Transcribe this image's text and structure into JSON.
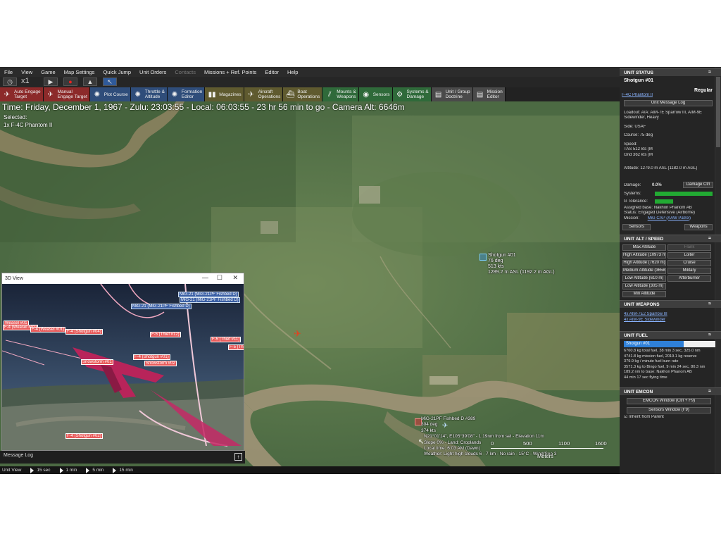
{
  "menu": [
    "File",
    "View",
    "Game",
    "Map Settings",
    "Quick Jump",
    "Unit Orders",
    "Contacts",
    "Missions + Ref. Points",
    "Editor",
    "Help"
  ],
  "sim": {
    "speed": "x1"
  },
  "toolbar": [
    {
      "label": "Auto Engage\nTarget",
      "icon": "crosshair-icon",
      "glyph": "✈",
      "style": "red"
    },
    {
      "label": "Manual\nEngage Target",
      "icon": "crosshair-icon",
      "glyph": "✈",
      "style": "red"
    },
    {
      "label": "Plot Course",
      "icon": "compass-icon",
      "glyph": "✺",
      "style": "blue"
    },
    {
      "label": "Throttle &\nAltitude",
      "icon": "gauge-icon",
      "glyph": "✺",
      "style": "blue"
    },
    {
      "label": "Formation\nEditor",
      "icon": "formation-icon",
      "glyph": "✺",
      "style": "blue"
    },
    {
      "label": "Magazines",
      "icon": "ammo-icon",
      "glyph": "▮▮",
      "style": "olive"
    },
    {
      "label": "Aircraft\nOperations",
      "icon": "aircraft-icon",
      "glyph": "✈",
      "style": "olive"
    },
    {
      "label": "Boat\nOperations",
      "icon": "boat-icon",
      "glyph": "⛴",
      "style": "olive"
    },
    {
      "label": "Mounts &\nWeapons",
      "icon": "mounts-icon",
      "glyph": "⫽",
      "style": "green"
    },
    {
      "label": "Sensors",
      "icon": "radar-icon",
      "glyph": "◉",
      "style": "green"
    },
    {
      "label": "Systems &\nDamage",
      "icon": "gear-icon",
      "glyph": "⚙",
      "style": "green"
    },
    {
      "label": "Unit / Group\nDoctrine",
      "icon": "doctrine-icon",
      "glyph": "▤",
      "style": "grey"
    },
    {
      "label": "Mission\nEditor",
      "icon": "mission-icon",
      "glyph": "▤",
      "style": "grey"
    }
  ],
  "map": {
    "time": "Time: Friday, December 1, 1967 - Zulu: 23:03:55 - Local: 06:03:55 - 23 hr 56 min to go -  Camera Alt: 6646m",
    "selected_label": "Selected:",
    "selected_unit": "1x F-4C Phantom II",
    "shotgun": [
      "Shotgun #01",
      "76 deg",
      "513 kts",
      "1289.2 m ASL (1192.2 m AGL)"
    ],
    "mig": [
      "MiG-21PF Fishbed D #389",
      "304 deg",
      "374 kts",
      "N21°01'14\", E105°39'08\" - 1.19nm from sel - Elevation 11m",
      "Slope 0% - Land: Croplands",
      "Local time: 6:03 AM (Dawn)",
      "Weather: Light high clouds 6 - 7 km - No rain - 15°C - Wind/Sea 3"
    ],
    "scale_ticks": [
      "0",
      "500",
      "1100",
      "1600"
    ],
    "scale_unit": "Meters"
  },
  "view3d": {
    "title": "3D View",
    "labels_blue": [
      "MiG-21 (MiG-21PF Fishbed D)",
      "MiG-21 (MiG-21PF Fishbed D)",
      "MiG-21 (MiG-21PF Fishbed D)"
    ],
    "labels_red": [
      "Weasel #01",
      "F-4 (Weasel #02)",
      "F-4 (Weasel #01)",
      "F-4 (Shotgun #04)",
      "F-5 (Thief #12)",
      "F-5 (Thief #11)",
      "F-5 (Thief #10)",
      "F-4 (Shotgun #01)",
      "Snowstorm #01",
      "Snowstorm #02",
      "F-4 (Shotgun #02)"
    ]
  },
  "message_log": "Message Log",
  "bottom": {
    "unit_view": "Unit View",
    "steps": [
      "15 sec",
      "1 min",
      "5 min",
      "15 min"
    ]
  },
  "panel": {
    "status_header": "UNIT STATUS",
    "unit_name": "Shotgun #01",
    "proficiency": "Regular",
    "unit_class": "F-4C Phantom II",
    "msg_log_btn": "Unit Message Log",
    "loadout": [
      "Loadout: A/A: AIM-7E Sparrow III, AIM-9E",
      "Sidewinder, Heavy"
    ],
    "side": "Side: USAF",
    "course": "Course: 75 deg",
    "speed": [
      "Speed:",
      "TAS 512 kts (M",
      "Gnd 362 kts (M"
    ],
    "altitude": "Altitude: 1279.0 m ASL (1182.0 m AGL)",
    "damage_label": "Damage:",
    "damage_value": "0.0%",
    "damage_btn": "Damage Ctrl",
    "systems_label": "Systems:",
    "systems_level": 1.0,
    "gtol_label": "G Tolerance:",
    "gtol_level": 1.0,
    "base": [
      "Assigned base: Nakhon Phanom AB",
      "Status: Engaged Defensive (Airborne)"
    ],
    "mission_label": "Mission:",
    "mission_value": "MiG CAP (AAW Patrol)",
    "sensors_btn": "Sensors",
    "weapons_btn": "Weapons",
    "altspeed_header": "UNIT ALT / SPEED",
    "alt_buttons": [
      "Max Altitude",
      "High Altitude (10973 m)",
      "High Altitude (7620 m)",
      "Medium Altitude (3658 m)",
      "Low Altitude (610 m)",
      "Low Altitude (305 m)",
      "Min Altitude"
    ],
    "speed_buttons": [
      "Loiter",
      "Cruise",
      "Military",
      "Afterburner"
    ],
    "speed_top": "Flank",
    "weapons_header": "UNIT WEAPONS",
    "weapons": [
      "4x AIM-7E2 Sparrow III",
      "4x AIM-9E Sidewinder"
    ],
    "fuel_header": "UNIT FUEL",
    "fuel_name": "Shotgun #01",
    "fuel_level": 0.65,
    "fuel_lines": [
      "6760.8 kg total fuel, 38 min 3 sec, 325.0 nm",
      "4741.8 kg mission fuel, 2019.1 kg reserve",
      "379.9 kg / minute fuel burn rate",
      "3571.3 kg to Bingo fuel, 9 min 24 sec, 80.3 nm",
      "189.2 nm to base: Nakhon Phanom AB",
      "44 min 17 sec flying time"
    ],
    "emcon_header": "UNIT EMCON",
    "emcon_btn": "EMCON Window (Ctrl + F9)",
    "sensors_window_btn": "Sensors Window (F9)",
    "inherit": "Inherit from Parent"
  }
}
